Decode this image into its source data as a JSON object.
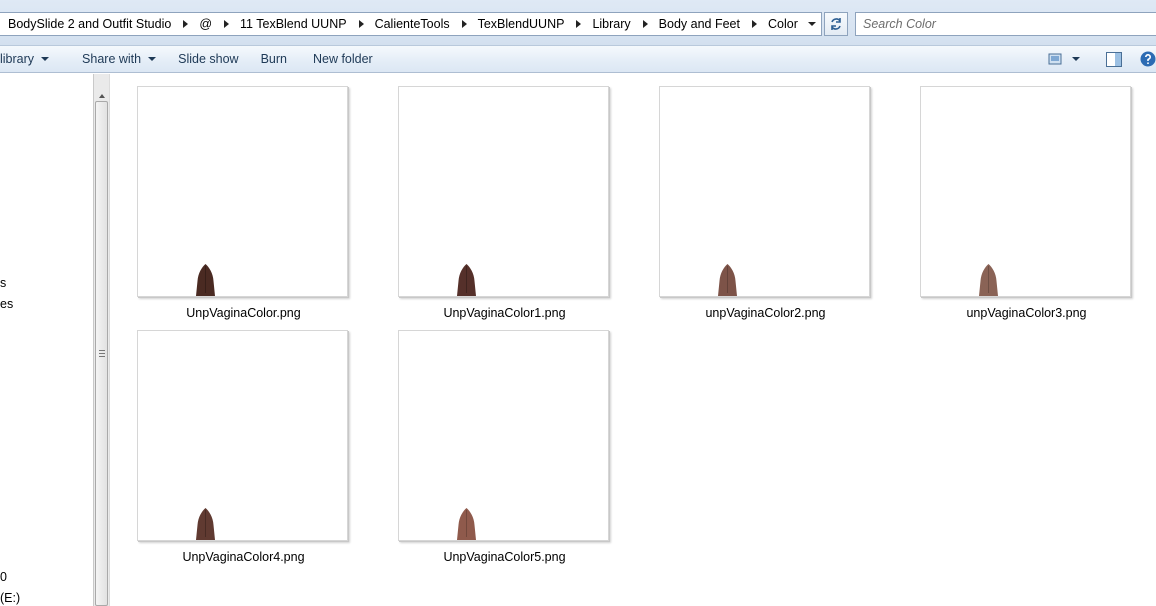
{
  "address_bar": {
    "breadcrumbs": [
      "BodySlide 2 and Outfit Studio",
      "@",
      "11 TexBlend UUNP",
      "CalienteTools",
      "TexBlendUUNP",
      "Library",
      "Body and Feet",
      "Color"
    ],
    "refresh_icon": "refresh-icon",
    "dropdown_icon": "chevron-down-icon"
  },
  "search": {
    "placeholder": "Search Color"
  },
  "command_bar": {
    "library_label": "library",
    "share_with_label": "Share with",
    "slide_show_label": "Slide show",
    "burn_label": "Burn",
    "new_folder_label": "New folder",
    "view_icon": "change-view-icon",
    "preview_pane_icon": "preview-pane-icon",
    "help_icon": "help-icon"
  },
  "nav_pane": {
    "fragments": [
      "s",
      "es",
      "0",
      "(E:)"
    ]
  },
  "files": [
    {
      "name": "UnpVaginaColor.png",
      "color": "#4a2a22"
    },
    {
      "name": "UnpVaginaColor1.png",
      "color": "#55302a"
    },
    {
      "name": "unpVaginaColor2.png",
      "color": "#7d5348"
    },
    {
      "name": "unpVaginaColor3.png",
      "color": "#8a6356"
    },
    {
      "name": "UnpVaginaColor4.png",
      "color": "#603a31"
    },
    {
      "name": "UnpVaginaColor5.png",
      "color": "#8f5a4c"
    }
  ],
  "colors": {
    "accent": "#1e3956",
    "chrome": "#dce7f4"
  }
}
